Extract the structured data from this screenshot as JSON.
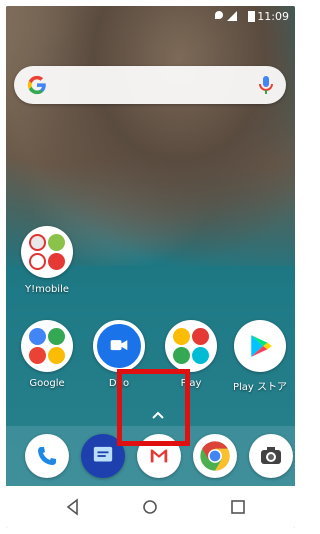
{
  "status_bar": {
    "time": "11:09",
    "icons": [
      "location-icon",
      "signal-icon",
      "battery-icon"
    ]
  },
  "search_bar": {
    "logo": "google-g-icon",
    "mic": "mic-icon"
  },
  "home": {
    "row1": [
      {
        "label": "Y!mobile",
        "icon": "folder-icon"
      }
    ],
    "row2": [
      {
        "label": "Google",
        "icon": "folder-icon"
      },
      {
        "label": "Duo",
        "icon": "duo-icon"
      },
      {
        "label": "Play",
        "icon": "folder-icon"
      },
      {
        "label": "Play ストア",
        "icon": "play-store-icon"
      }
    ]
  },
  "app_drawer_handle": {
    "icon": "chevron-up-icon"
  },
  "dock": [
    {
      "name": "Phone",
      "icon": "phone-icon"
    },
    {
      "name": "Messages",
      "icon": "messages-icon"
    },
    {
      "name": "Gmail",
      "icon": "gmail-icon"
    },
    {
      "name": "Chrome",
      "icon": "chrome-icon"
    },
    {
      "name": "Camera",
      "icon": "camera-icon"
    }
  ],
  "nav_bar": [
    "back-icon",
    "home-icon",
    "recents-icon"
  ],
  "colors": {
    "highlight": "#e01010"
  }
}
